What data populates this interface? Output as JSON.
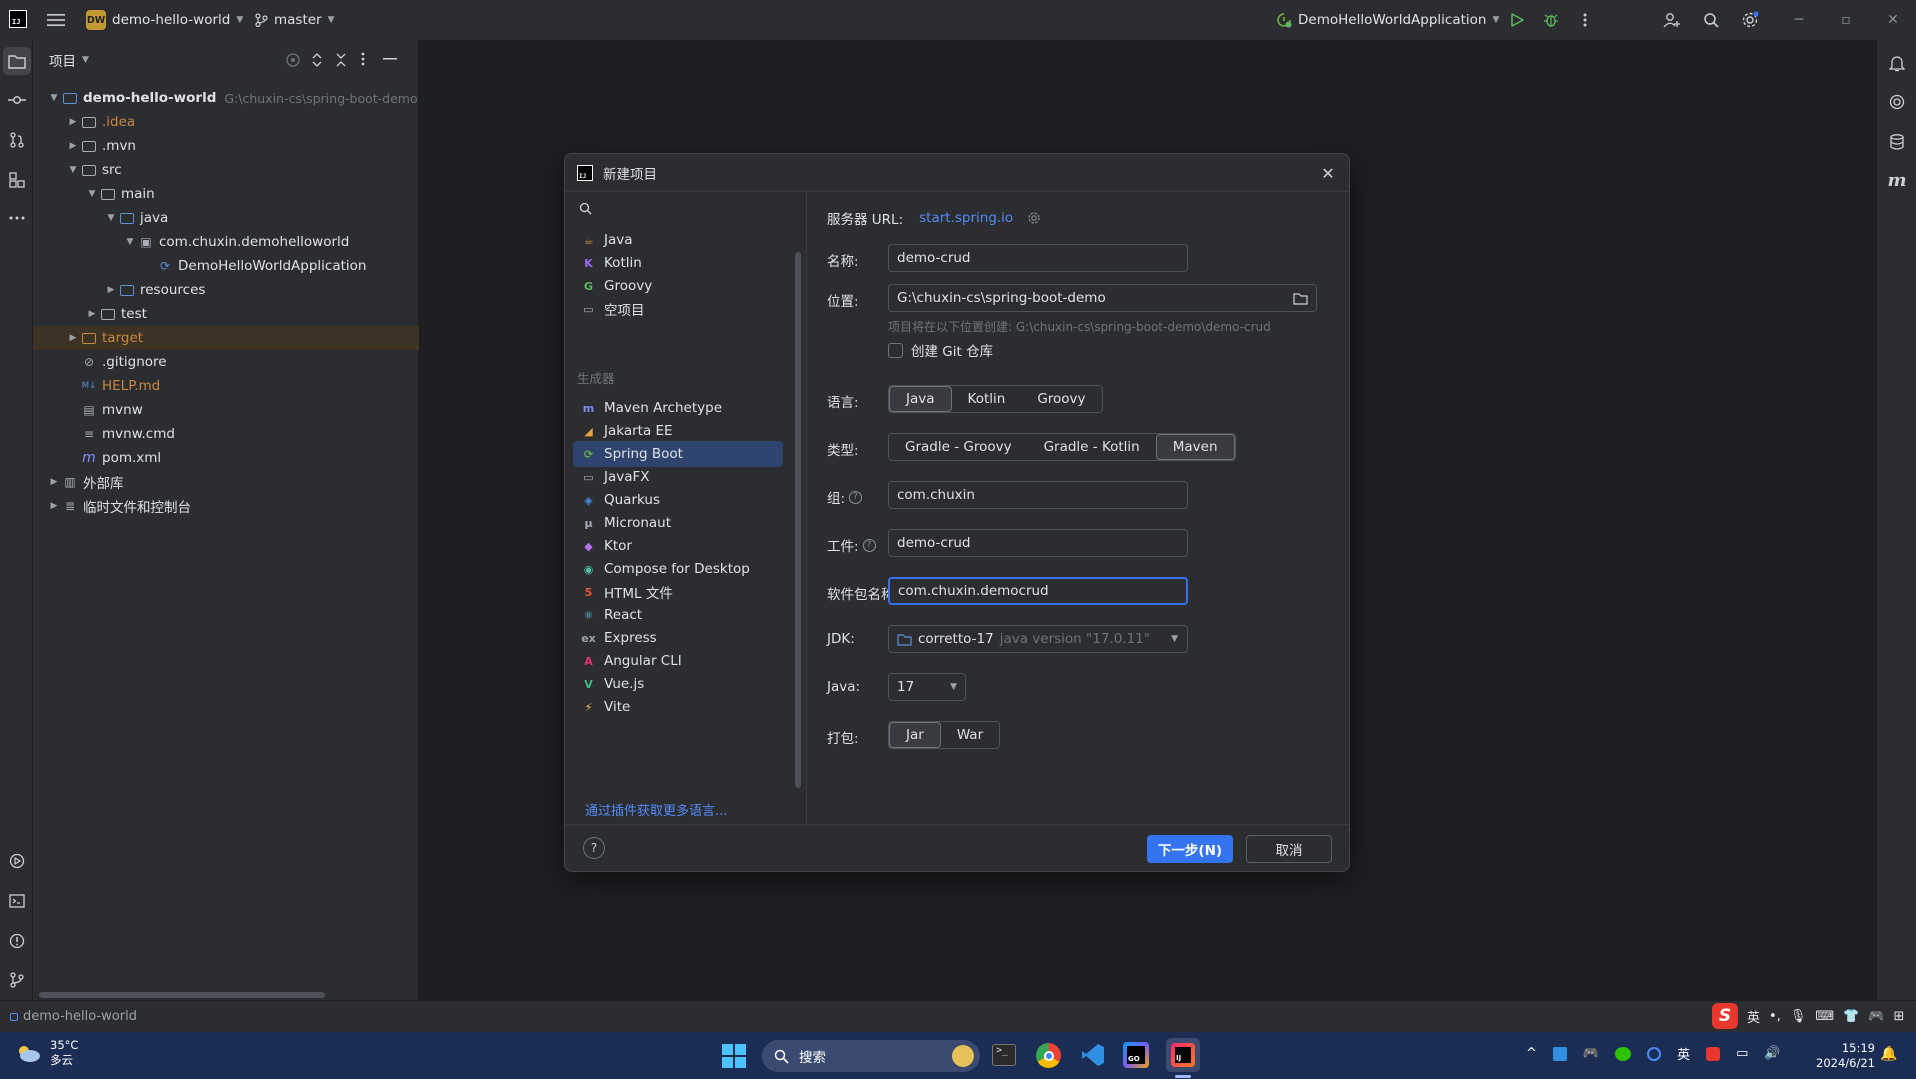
{
  "titlebar": {
    "project_badge": "DW",
    "project_name": "demo-hello-world",
    "branch": "master",
    "run_config": "DemoHelloWorldApplication"
  },
  "project_panel": {
    "title": "项目",
    "tree": [
      {
        "label": "demo-hello-world",
        "path": "G:\\chuxin-cs\\spring-boot-demo",
        "depth": 0,
        "arrow": "open",
        "icon": "module-folder-icon",
        "bold": true,
        "color": "#dfe1e5"
      },
      {
        "label": ".idea",
        "depth": 1,
        "arrow": "closed",
        "icon": "folder-icon",
        "color": "#c7883f"
      },
      {
        "label": ".mvn",
        "depth": 1,
        "arrow": "closed",
        "icon": "folder-icon",
        "color": "#dfe1e5"
      },
      {
        "label": "src",
        "depth": 1,
        "arrow": "open",
        "icon": "folder-icon",
        "color": "#dfe1e5"
      },
      {
        "label": "main",
        "depth": 2,
        "arrow": "open",
        "icon": "folder-icon",
        "color": "#dfe1e5"
      },
      {
        "label": "java",
        "depth": 3,
        "arrow": "open",
        "icon": "source-folder-icon",
        "color": "#dfe1e5"
      },
      {
        "label": "com.chuxin.demohelloworld",
        "depth": 4,
        "arrow": "open",
        "icon": "package-icon",
        "color": "#dfe1e5"
      },
      {
        "label": "DemoHelloWorldApplication",
        "depth": 5,
        "arrow": "none",
        "icon": "spring-class-icon",
        "color": "#dfe1e5"
      },
      {
        "label": "resources",
        "depth": 3,
        "arrow": "closed",
        "icon": "resources-folder-icon",
        "color": "#dfe1e5"
      },
      {
        "label": "test",
        "depth": 2,
        "arrow": "closed",
        "icon": "folder-icon",
        "color": "#dfe1e5"
      },
      {
        "label": "target",
        "depth": 1,
        "arrow": "closed",
        "icon": "excluded-folder-icon",
        "color": "#c7883f",
        "highlight": true
      },
      {
        "label": ".gitignore",
        "depth": 1,
        "arrow": "none",
        "icon": "ignore-file-icon",
        "color": "#dfe1e5"
      },
      {
        "label": "HELP.md",
        "depth": 1,
        "arrow": "none",
        "icon": "markdown-icon",
        "color": "#c7883f"
      },
      {
        "label": "mvnw",
        "depth": 1,
        "arrow": "none",
        "icon": "shell-file-icon",
        "color": "#dfe1e5"
      },
      {
        "label": "mvnw.cmd",
        "depth": 1,
        "arrow": "none",
        "icon": "text-file-icon",
        "color": "#dfe1e5"
      },
      {
        "label": "pom.xml",
        "depth": 1,
        "arrow": "none",
        "icon": "maven-file-icon",
        "color": "#dfe1e5"
      },
      {
        "label": "外部库",
        "depth": 0,
        "arrow": "closed",
        "icon": "library-icon",
        "color": "#dfe1e5"
      },
      {
        "label": "临时文件和控制台",
        "depth": 0,
        "arrow": "closed",
        "icon": "scratches-icon",
        "color": "#dfe1e5"
      }
    ]
  },
  "dialog": {
    "title": "新建项目",
    "search_placeholder": "",
    "left_items": [
      {
        "label": "Java",
        "icon": "java-icon",
        "color": "#c7883f",
        "glyph": "☕"
      },
      {
        "label": "Kotlin",
        "icon": "kotlin-icon",
        "color": "#9b6bff",
        "glyph": "K"
      },
      {
        "label": "Groovy",
        "icon": "groovy-icon",
        "color": "#5fb85f",
        "glyph": "G"
      },
      {
        "label": "空项目",
        "icon": "empty-project-icon",
        "color": "#a9acb4",
        "glyph": "▭"
      }
    ],
    "generators_label": "生成器",
    "generators": [
      {
        "label": "Maven Archetype",
        "icon": "maven-icon",
        "color": "#7f8cf5",
        "glyph": "m",
        "selected": false
      },
      {
        "label": "Jakarta EE",
        "icon": "jakarta-ee-icon",
        "color": "#e5a43a",
        "glyph": "◢",
        "selected": false
      },
      {
        "label": "Spring Boot",
        "icon": "spring-boot-icon",
        "color": "#6db33f",
        "glyph": "⟳",
        "selected": true
      },
      {
        "label": "JavaFX",
        "icon": "javafx-icon",
        "color": "#a9acb4",
        "glyph": "▭",
        "selected": false
      },
      {
        "label": "Quarkus",
        "icon": "quarkus-icon",
        "color": "#4695eb",
        "glyph": "◈",
        "selected": false
      },
      {
        "label": "Micronaut",
        "icon": "micronaut-icon",
        "color": "#a9acb4",
        "glyph": "μ",
        "selected": false
      },
      {
        "label": "Ktor",
        "icon": "ktor-icon",
        "color": "#b86ef5",
        "glyph": "◆",
        "selected": false
      },
      {
        "label": "Compose for Desktop",
        "icon": "compose-icon",
        "color": "#4fc1a6",
        "glyph": "◉",
        "selected": false
      },
      {
        "label": "HTML 文件",
        "icon": "html-icon",
        "color": "#e4572e",
        "glyph": "5",
        "selected": false
      },
      {
        "label": "React",
        "icon": "react-icon",
        "color": "#61dafb",
        "glyph": "⚛",
        "selected": false
      },
      {
        "label": "Express",
        "icon": "express-icon",
        "color": "#9da0a8",
        "glyph": "ex",
        "selected": false
      },
      {
        "label": "Angular CLI",
        "icon": "angular-icon",
        "color": "#e3346f",
        "glyph": "A",
        "selected": false
      },
      {
        "label": "Vue.js",
        "icon": "vue-icon",
        "color": "#41b883",
        "glyph": "V",
        "selected": false
      },
      {
        "label": "Vite",
        "icon": "vite-icon",
        "color": "#f5c842",
        "glyph": "⚡",
        "selected": false
      }
    ],
    "plugin_link": "通过插件获取更多语言...",
    "server_url_label": "服务器 URL:",
    "server_url": "start.spring.io",
    "name_label": "名称:",
    "name_value": "demo-crud",
    "location_label": "位置:",
    "location_value": "G:\\chuxin-cs\\spring-boot-demo",
    "location_hint": "项目将在以下位置创建: G:\\chuxin-cs\\spring-boot-demo\\demo-crud",
    "git_label": "创建 Git 仓库",
    "language_label": "语言:",
    "languages": [
      "Java",
      "Kotlin",
      "Groovy"
    ],
    "language_selected": "Java",
    "type_label": "类型:",
    "types": [
      "Gradle - Groovy",
      "Gradle - Kotlin",
      "Maven"
    ],
    "type_selected": "Maven",
    "group_label": "组:",
    "group_value": "com.chuxin",
    "artifact_label": "工件:",
    "artifact_value": "demo-crud",
    "package_label": "软件包名称:",
    "package_value": "com.chuxin.democrud",
    "jdk_label": "JDK:",
    "jdk_name": "corretto-17",
    "jdk_version": "java version \"17.0.11\"",
    "java_label": "Java:",
    "java_value": "17",
    "packaging_label": "打包:",
    "packagings": [
      "Jar",
      "War"
    ],
    "packaging_selected": "Jar",
    "next_button": "下一步(N)",
    "cancel_button": "取消",
    "help_glyph": "?"
  },
  "statusbar": {
    "breadcrumb": "demo-hello-world"
  },
  "taskbar": {
    "weather_temp": "35°C",
    "weather_text": "多云",
    "search_label": "搜索",
    "ime_label": "英",
    "time": "15:19",
    "date": "2024/6/21"
  },
  "colors": {
    "accent": "#3574f0",
    "selection": "#2e436e",
    "link": "#548af7"
  }
}
